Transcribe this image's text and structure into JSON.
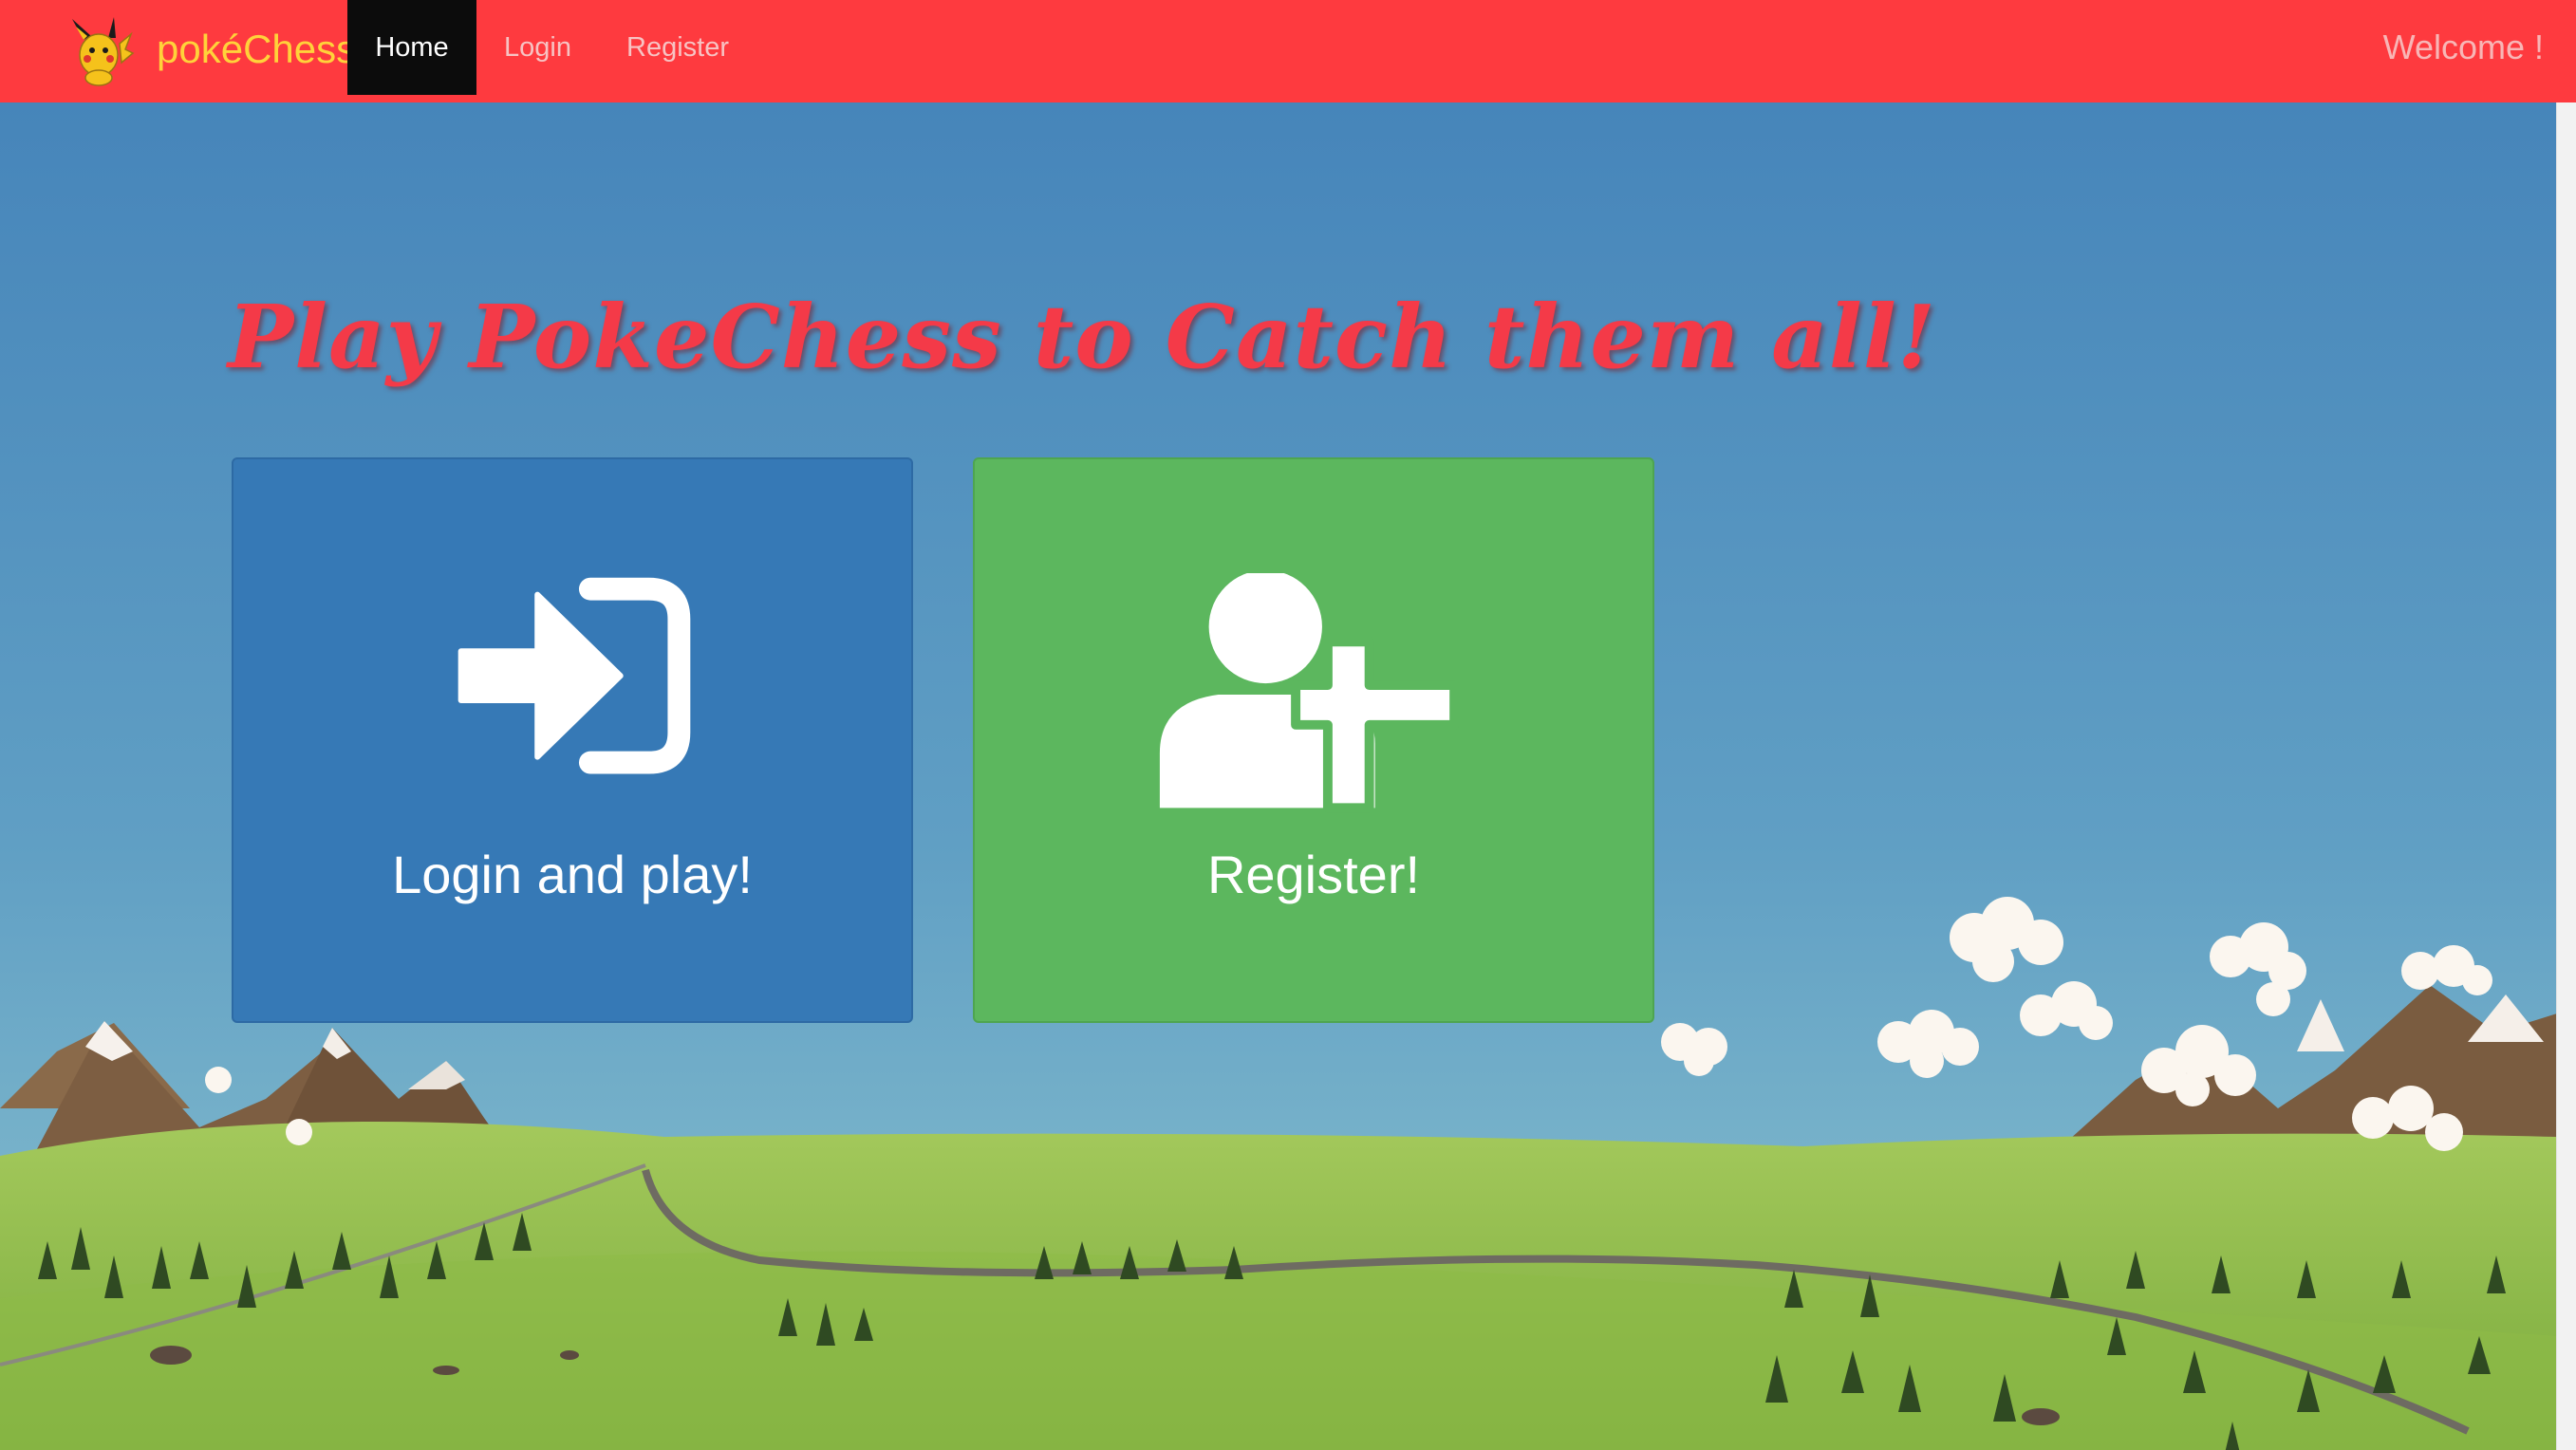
{
  "nav": {
    "brand": "pokéChess",
    "items": [
      {
        "label": "Home",
        "active": true
      },
      {
        "label": "Login",
        "active": false
      },
      {
        "label": "Register",
        "active": false
      }
    ],
    "welcome": "Welcome !"
  },
  "hero": {
    "headline": "Play PokeChess to Catch them all!"
  },
  "tiles": {
    "login": {
      "label": "Login and play!",
      "icon": "sign-in-icon"
    },
    "register": {
      "label": "Register!",
      "icon": "user-plus-icon"
    }
  },
  "colors": {
    "navbar": "#fe3a3f",
    "brand": "#ffd23a",
    "headline": "#f43a48",
    "login_tile": "#3679b6",
    "register_tile": "#5cb75e"
  }
}
